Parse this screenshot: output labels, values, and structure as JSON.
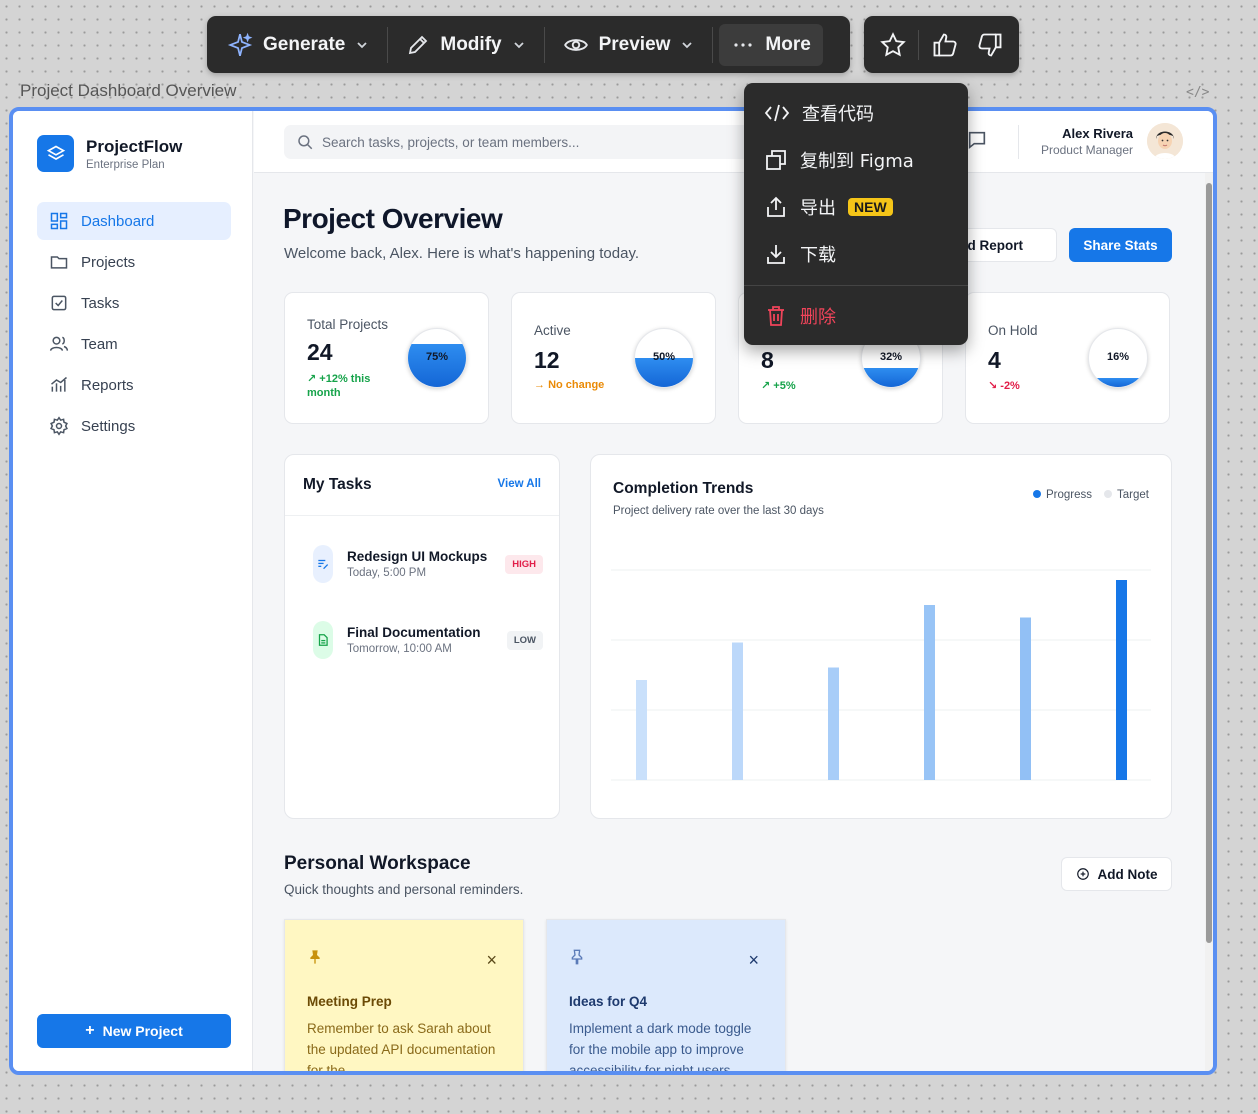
{
  "toolbar": {
    "generate_label": "Generate",
    "modify_label": "Modify",
    "preview_label": "Preview",
    "more_label": "More"
  },
  "frame": {
    "label": "Project Dashboard Overview",
    "code_glyph": "</>"
  },
  "menu": {
    "items": [
      {
        "label": "查看代码",
        "icon": "code-icon"
      },
      {
        "label": "复制到 Figma",
        "icon": "copy-icon"
      },
      {
        "label": "导出",
        "icon": "export-icon",
        "badge": "NEW"
      },
      {
        "label": "下载",
        "icon": "download-icon"
      },
      {
        "label": "删除",
        "icon": "trash-icon"
      }
    ]
  },
  "sidebar": {
    "brand_name": "ProjectFlow",
    "brand_plan": "Enterprise Plan",
    "items": [
      {
        "label": "Dashboard",
        "icon": "dashboard-icon"
      },
      {
        "label": "Projects",
        "icon": "folder-icon"
      },
      {
        "label": "Tasks",
        "icon": "checkbox-icon"
      },
      {
        "label": "Team",
        "icon": "users-icon"
      },
      {
        "label": "Reports",
        "icon": "chart-icon"
      },
      {
        "label": "Settings",
        "icon": "gear-icon"
      }
    ],
    "new_project_label": "New Project",
    "new_project_glyph": "+"
  },
  "header": {
    "search_placeholder": "Search tasks, projects, or team members...",
    "user_name": "Alex Rivera",
    "user_role": "Product Manager"
  },
  "main": {
    "title": "Project Overview",
    "subtitle": "Welcome back, Alex. Here is what's happening today.",
    "download_report_label": "load Report",
    "share_stats_label": "Share Stats"
  },
  "stats": [
    {
      "label": "Total Projects",
      "value": "24",
      "trend_arrow": "↗",
      "trend": "+12% this month",
      "trend_kind": "up",
      "gauge_pct": 75,
      "gauge_label": "75%"
    },
    {
      "label": "Active",
      "value": "12",
      "trend_arrow": "→",
      "trend": "No change",
      "trend_kind": "flat",
      "gauge_pct": 50,
      "gauge_label": "50%"
    },
    {
      "label": "",
      "value": "8",
      "trend_arrow": "↗",
      "trend": "+5%",
      "trend_kind": "up",
      "gauge_pct": 32,
      "gauge_label": "32%"
    },
    {
      "label": "On Hold",
      "value": "4",
      "trend_arrow": "↘",
      "trend": "-2%",
      "trend_kind": "down",
      "gauge_pct": 16,
      "gauge_label": "16%"
    }
  ],
  "tasks": {
    "title": "My Tasks",
    "view_all_label": "View All",
    "items": [
      {
        "title": "Redesign UI Mockups",
        "time": "Today, 5:00 PM",
        "priority": "HIGH",
        "priority_kind": "high",
        "icon": "edit-doc-icon"
      },
      {
        "title": "Final Documentation",
        "time": "Tomorrow, 10:00 AM",
        "priority": "LOW",
        "priority_kind": "low",
        "icon": "document-icon"
      }
    ]
  },
  "trends": {
    "title": "Completion Trends",
    "subtitle": "Project delivery rate over the last 30 days",
    "legend": [
      {
        "name": "Progress",
        "color": "#1677e8"
      },
      {
        "name": "Target",
        "color": "#e5e7eb"
      }
    ]
  },
  "chart_data": {
    "type": "bar",
    "title": "Completion Trends",
    "subtitle": "Project delivery rate over the last 30 days",
    "categories": [
      "",
      "",
      "",
      "",
      "",
      ""
    ],
    "values": [
      40,
      55,
      45,
      70,
      65,
      80
    ],
    "ylim": [
      0,
      80
    ],
    "legend_position": "top-right",
    "colors": [
      "#c9e0fb",
      "#bcd8fa",
      "#a8cdf8",
      "#98c4f6",
      "#92c0f5",
      "#1677e8"
    ],
    "grid": true,
    "xlabel": "",
    "ylabel": ""
  },
  "workspace": {
    "title": "Personal Workspace",
    "subtitle": "Quick thoughts and personal reminders.",
    "add_note_label": "Add Note",
    "notes": [
      {
        "title": "Meeting Prep",
        "body": "Remember to ask Sarah about the updated API documentation for the",
        "color": "yellow"
      },
      {
        "title": "Ideas for Q4",
        "body": "Implement a dark mode toggle for the mobile app to improve accessibility for night users",
        "color": "blue"
      }
    ],
    "close_glyph": "×"
  },
  "colors": {
    "accent": "#1677e8",
    "frame_border": "#5a8ff2",
    "danger": "#f0445a",
    "new_badge": "#f5c518"
  }
}
